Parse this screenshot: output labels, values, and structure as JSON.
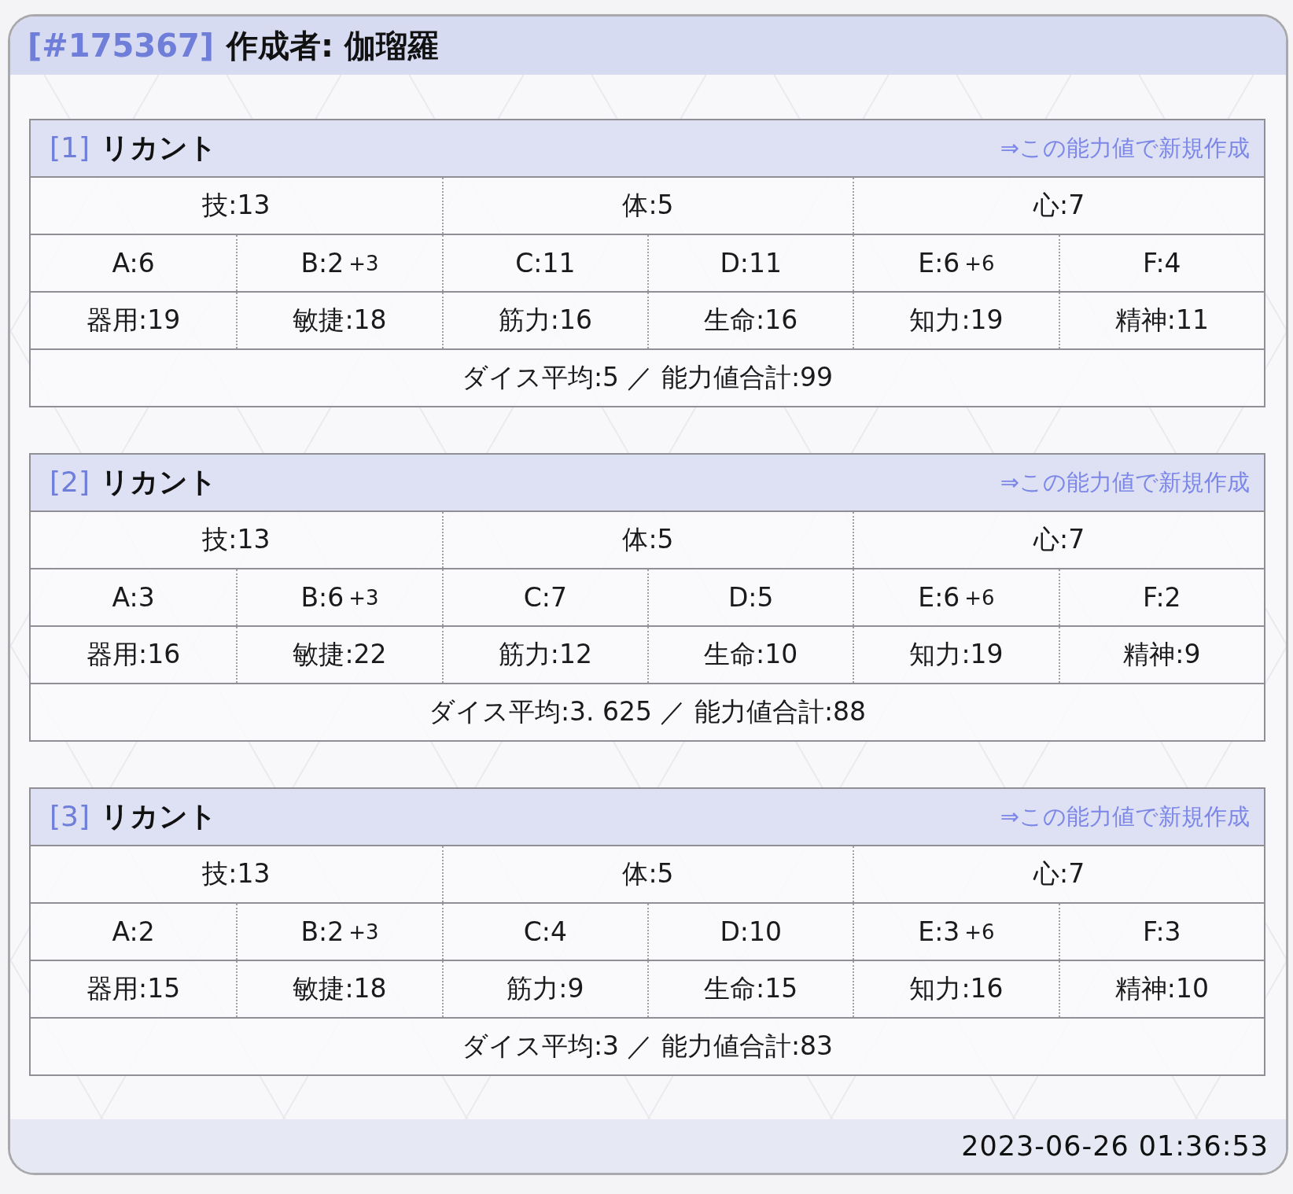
{
  "header": {
    "id": "[#175367]",
    "author": "作成者: 伽瑠羅"
  },
  "results": [
    {
      "index": "[1]",
      "race": "リカント",
      "link": "⇒この能力値で新規作成",
      "groups": [
        "技:13",
        "体:5",
        "心:7"
      ],
      "abilities": [
        {
          "text": "A:6"
        },
        {
          "text": "B:2",
          "bonus": "+3"
        },
        {
          "text": "C:11"
        },
        {
          "text": "D:11"
        },
        {
          "text": "E:6",
          "bonus": "+6"
        },
        {
          "text": "F:4"
        }
      ],
      "stats": [
        "器用:19",
        "敏捷:18",
        "筋力:16",
        "生命:16",
        "知力:19",
        "精神:11"
      ],
      "summary": "ダイス平均:5 ／ 能力値合計:99"
    },
    {
      "index": "[2]",
      "race": "リカント",
      "link": "⇒この能力値で新規作成",
      "groups": [
        "技:13",
        "体:5",
        "心:7"
      ],
      "abilities": [
        {
          "text": "A:3"
        },
        {
          "text": "B:6",
          "bonus": "+3"
        },
        {
          "text": "C:7"
        },
        {
          "text": "D:5"
        },
        {
          "text": "E:6",
          "bonus": "+6"
        },
        {
          "text": "F:2"
        }
      ],
      "stats": [
        "器用:16",
        "敏捷:22",
        "筋力:12",
        "生命:10",
        "知力:19",
        "精神:9"
      ],
      "summary": "ダイス平均:3. 625 ／ 能力値合計:88"
    },
    {
      "index": "[3]",
      "race": "リカント",
      "link": "⇒この能力値で新規作成",
      "groups": [
        "技:13",
        "体:5",
        "心:7"
      ],
      "abilities": [
        {
          "text": "A:2"
        },
        {
          "text": "B:2",
          "bonus": "+3"
        },
        {
          "text": "C:4"
        },
        {
          "text": "D:10"
        },
        {
          "text": "E:3",
          "bonus": "+6"
        },
        {
          "text": "F:3"
        }
      ],
      "stats": [
        "器用:15",
        "敏捷:18",
        "筋力:9",
        "生命:15",
        "知力:16",
        "精神:10"
      ],
      "summary": "ダイス平均:3 ／ 能力値合計:83"
    }
  ],
  "footer": {
    "timestamp": "2023-06-26 01:36:53"
  }
}
